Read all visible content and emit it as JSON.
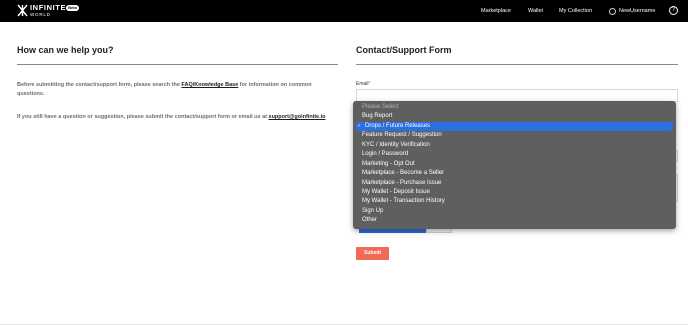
{
  "header": {
    "logo_word1": "INFINITE",
    "logo_word2": "WORLD",
    "beta_badge": "Beta",
    "nav": [
      "Marketplace",
      "Wallet",
      "My Collection"
    ],
    "username": "NewUsername",
    "help_glyph": "?"
  },
  "left": {
    "title": "How can we help you?",
    "p1_before": "Before submitting the contact/support form, please search the ",
    "p1_link": "FAQ/Knowledge Base",
    "p1_after": " for information on common questions.",
    "p2_before": "If you still have a question or suggestion, please submit the contact/support form or email us at ",
    "p2_link": "support@goinfinite.io"
  },
  "form": {
    "title": "Contact/Support Form",
    "email_label": "Email",
    "required_mark": "*",
    "submit_label": "Submit"
  },
  "dropdown": {
    "options": [
      "Please Select",
      "Bug Report",
      "Drops / Future Releases",
      "Feature Request / Suggestion",
      "KYC / Identity Verification",
      "Login / Password",
      "Marketing - Opt Out",
      "Marketplace - Become a Seller",
      "Marketplace - Purchase Issue",
      "My Wallet - Deposit Issue",
      "My Wallet - Transaction History",
      "Sign Up",
      "Other"
    ],
    "selected": "Drops / Future Releases",
    "check_glyph": "✓"
  },
  "colors": {
    "accent_submit": "#f06a55",
    "selected_option": "#2b6fe0",
    "header_bg": "#000000"
  }
}
